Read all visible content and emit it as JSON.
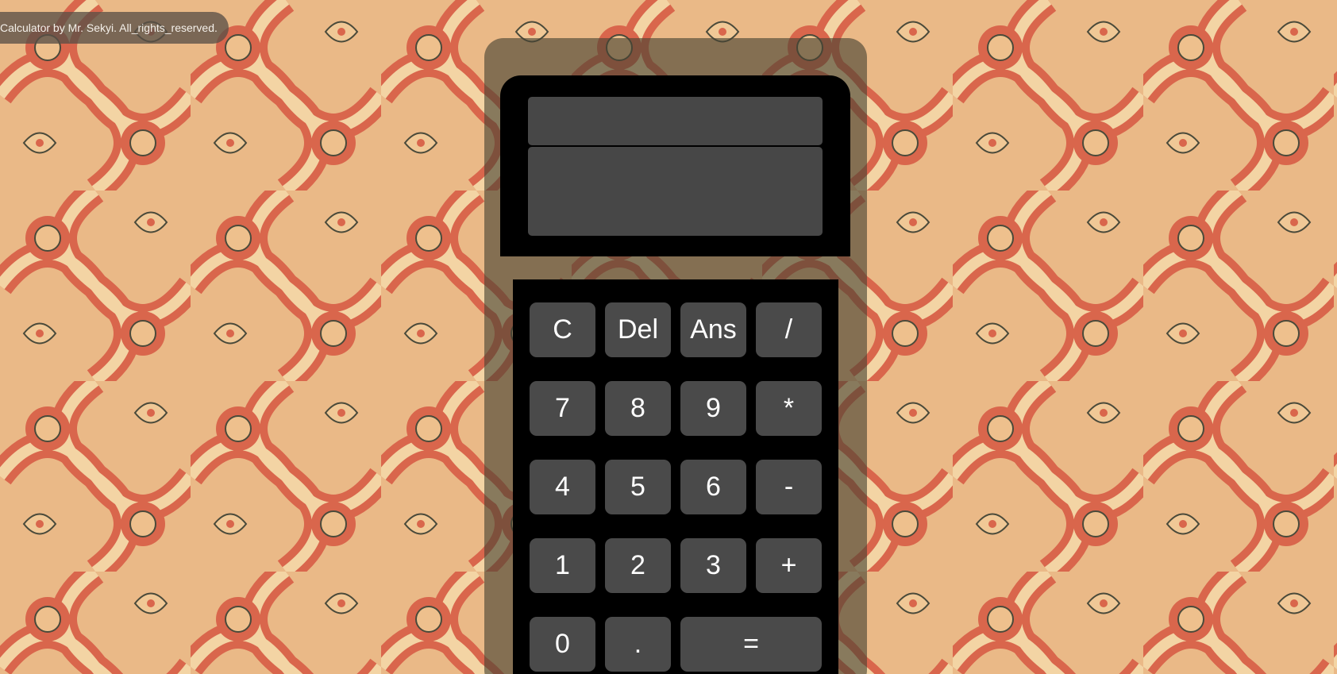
{
  "banner": {
    "text": "Calculator by Mr. Sekyi. All_rights_reserved."
  },
  "display": {
    "expression": "",
    "result": ""
  },
  "keypad": {
    "rows": [
      [
        {
          "label": "C",
          "name": "clear-button"
        },
        {
          "label": "Del",
          "name": "delete-button"
        },
        {
          "label": "Ans",
          "name": "answer-button"
        },
        {
          "label": "/",
          "name": "divide-button"
        }
      ],
      [
        {
          "label": "7",
          "name": "digit-7-button"
        },
        {
          "label": "8",
          "name": "digit-8-button"
        },
        {
          "label": "9",
          "name": "digit-9-button"
        },
        {
          "label": "*",
          "name": "multiply-button"
        }
      ],
      [
        {
          "label": "4",
          "name": "digit-4-button"
        },
        {
          "label": "5",
          "name": "digit-5-button"
        },
        {
          "label": "6",
          "name": "digit-6-button"
        },
        {
          "label": "-",
          "name": "subtract-button"
        }
      ],
      [
        {
          "label": "1",
          "name": "digit-1-button"
        },
        {
          "label": "2",
          "name": "digit-2-button"
        },
        {
          "label": "3",
          "name": "digit-3-button"
        },
        {
          "label": "+",
          "name": "add-button"
        }
      ],
      [
        {
          "label": "0",
          "name": "digit-0-button"
        },
        {
          "label": ".",
          "name": "decimal-point-button"
        },
        {
          "label": "=",
          "name": "equals-button"
        }
      ]
    ]
  },
  "colors": {
    "background_pattern": "#e9b98a",
    "pattern_red": "#d9664c",
    "calculator_body": "#000000",
    "key_background": "#4a4a4a",
    "key_text": "#ffffff"
  }
}
